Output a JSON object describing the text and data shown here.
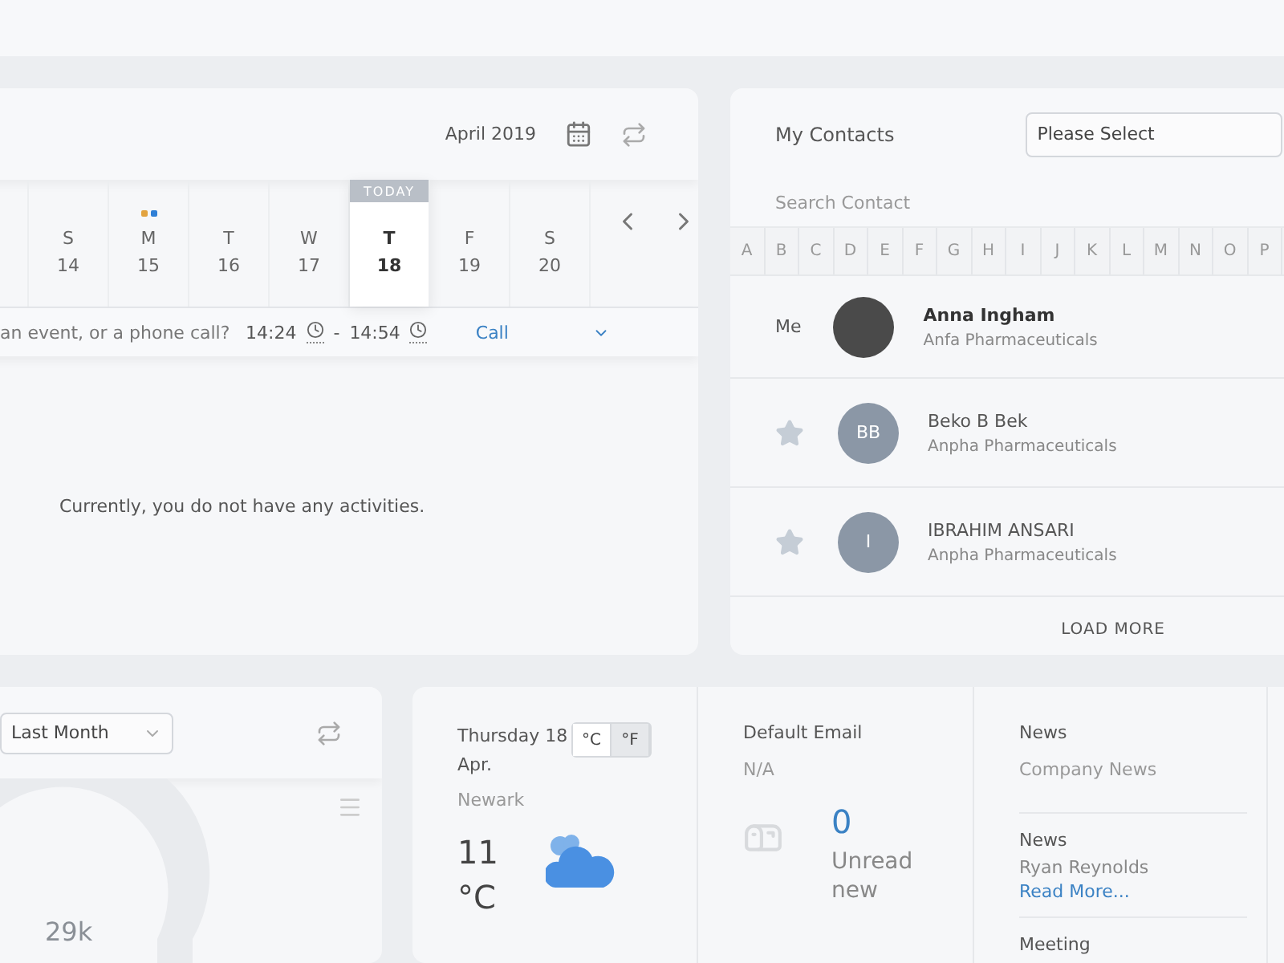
{
  "calendar": {
    "month": "April 2019",
    "today_label": "TODAY",
    "days": [
      {
        "weekday": "S",
        "date": "14",
        "selected": false
      },
      {
        "weekday": "M",
        "date": "15",
        "selected": false,
        "dots": [
          {
            "color": "#e2a33f"
          },
          {
            "color": "#2f7fd6"
          }
        ]
      },
      {
        "weekday": "T",
        "date": "16",
        "selected": false
      },
      {
        "weekday": "W",
        "date": "17",
        "selected": false
      },
      {
        "weekday": "T",
        "date": "18",
        "selected": true
      },
      {
        "weekday": "F",
        "date": "19",
        "selected": false
      },
      {
        "weekday": "S",
        "date": "20",
        "selected": false
      }
    ],
    "event": {
      "placeholder": "an event, or a phone call?",
      "start": "14:24",
      "separator": "-",
      "end": "14:54",
      "type": "Call"
    },
    "empty_message": "Currently, you do not have any activities."
  },
  "contacts": {
    "title": "My Contacts",
    "filter": {
      "value": "Please Select"
    },
    "search": {
      "placeholder": "Search Contact"
    },
    "letters": [
      "A",
      "B",
      "C",
      "D",
      "E",
      "F",
      "G",
      "H",
      "I",
      "J",
      "K",
      "L",
      "M",
      "N",
      "O",
      "P"
    ],
    "me": {
      "label": "Me",
      "name": "Anna Ingham",
      "company": "Anfa Pharmaceuticals"
    },
    "items": [
      {
        "initials": "BB",
        "name": "Beko B Bek",
        "company": "Anpha Pharmaceuticals",
        "starred": false
      },
      {
        "initials": "I",
        "name": "IBRAHIM ANSARI",
        "company": "Anpha Pharmaceuticals",
        "starred": false
      }
    ],
    "load_more": "LOAD MORE"
  },
  "stats": {
    "period": "Last Month",
    "center_label": "29k"
  },
  "weather": {
    "date": "Thursday 18 Apr.",
    "units": [
      {
        "label": "°C",
        "selected": false
      },
      {
        "label": "°F",
        "selected": true
      }
    ],
    "city": "Newark",
    "temperature": "11",
    "unit": "°C"
  },
  "email": {
    "title": "Default Email",
    "address": "N/A",
    "count": "0",
    "count_label": "Unread new"
  },
  "news": [
    {
      "kind": "plain",
      "title": "News",
      "text": "Company News"
    },
    {
      "kind": "link",
      "title": "News",
      "text": "Ryan Reynolds",
      "link": "Read More..."
    },
    {
      "kind": "title",
      "title": "Meeting"
    }
  ]
}
